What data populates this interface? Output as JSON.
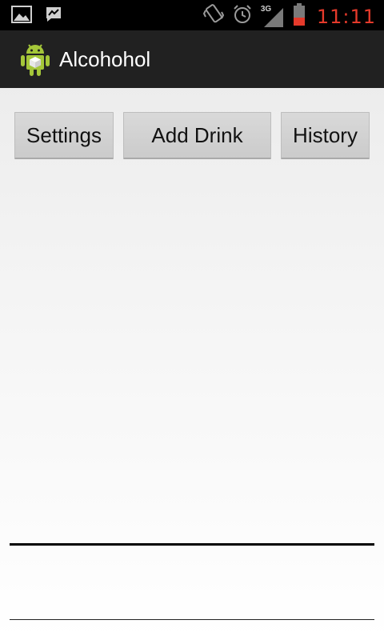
{
  "status_bar": {
    "time": "11:11",
    "network_type": "3G",
    "icons": [
      "gallery-icon",
      "messenger-icon",
      "vibrate-icon",
      "alarm-icon",
      "signal-icon",
      "battery-icon"
    ],
    "time_color": "#e53a2b"
  },
  "action_bar": {
    "title": "Alcohohol",
    "icon": "android-app-icon",
    "background": "#212121"
  },
  "buttons": {
    "settings": "Settings",
    "add_drink": "Add Drink",
    "history": "History"
  }
}
